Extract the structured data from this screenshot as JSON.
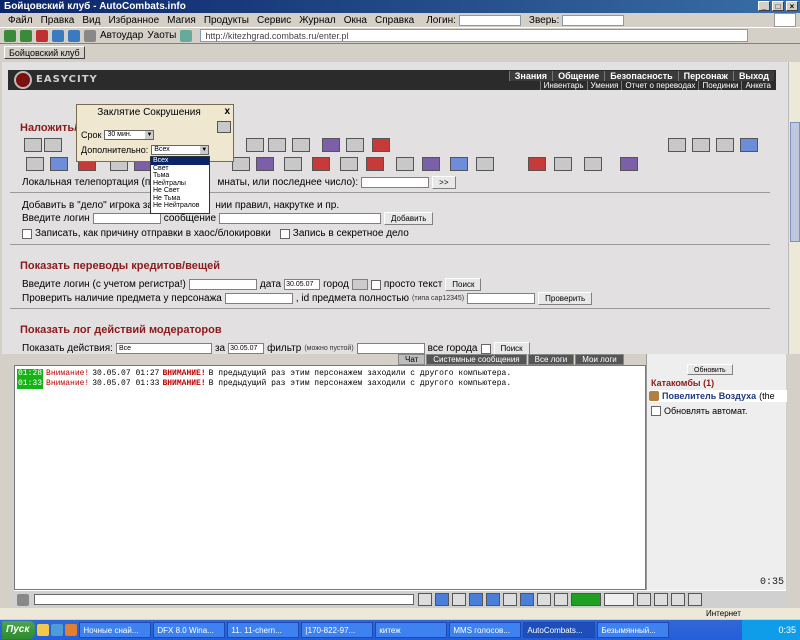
{
  "window": {
    "title": "Бойцовский клуб - AutoCombats.info"
  },
  "menu": [
    "Файл",
    "Правка",
    "Вид",
    "Избранное",
    "Магия",
    "Продукты",
    "Сервис",
    "Журнал",
    "Окна",
    "Справка"
  ],
  "menu_fields": {
    "login_label": "Логин:",
    "beast_label": "Зверь:"
  },
  "toolbar": {
    "autoudar": "Автоудар",
    "uaoty": "Уаоты",
    "address": "http://kitezhgrad.combats.ru/enter.pl"
  },
  "tab": {
    "label": "Бойцовский клуб"
  },
  "banner": {
    "brand": "EASYCITY",
    "nav_top": [
      "Знания",
      "Общение",
      "Безопасность",
      "Персонаж",
      "Выход"
    ],
    "nav_bottom": [
      "Инвентарь",
      "Умения",
      "Отчет о переводах",
      "Поединки",
      "Анкета"
    ]
  },
  "section1": {
    "title": "Наложить/сн",
    "teleport_label": "Локальная телепортация (пол",
    "teleport_label2": "мнаты, или последнее число):",
    "teleport_btn": ">>",
    "delo_label": "Добавить в \"дело\" игрока заме",
    "delo_label2": "нии правил, накрутке и пр.",
    "login_label": "Введите логин",
    "message_label": "сообщение",
    "add_btn": "Добавить",
    "chaos_label": "Записать, как причину отправки в хаос/блокировки",
    "secret_label": "Запись в секретное дело"
  },
  "popup": {
    "title": "Заклятие Сокрушения",
    "close": "x",
    "term_label": "Срок",
    "term_value": "30 мин.",
    "extra_label": "Дополнительно:",
    "extra_value": "Всех",
    "options": [
      "Всех",
      "Свет",
      "Тьма",
      "Нейтралы",
      "Не Свет",
      "Не Тьма",
      "Не Нейтралов"
    ]
  },
  "section2": {
    "title": "Показать переводы кредитов/вещей",
    "login_label": "Введите логин (с учетом регистра!)",
    "date_label": "дата",
    "date_value": "30.05.07",
    "city_label": "город",
    "plain_label": "просто текст",
    "search_btn": "Поиск",
    "check_label": "Проверить наличие предмета у персонажа",
    "item_id_label": ", id предмета полностью",
    "item_hint": "(типа cap12345)",
    "check_btn": "Проверить"
  },
  "section3": {
    "title": "Показать лог действий модераторов",
    "actions_label": "Показать действия:",
    "actions_value": "Все",
    "for_label": "за",
    "date_value": "30.05.07",
    "filter_label": "фильтр",
    "filter_hint": "(можно пустой)",
    "all_cities_label": "все города",
    "search_btn": "Поиск"
  },
  "chat_tabs": [
    "Чат",
    "Системные сообщения",
    "Все логи",
    "Мои логи"
  ],
  "chat_lines": [
    {
      "time": "01:28",
      "prefix": "Внимание!",
      "date": "30.05.07 01:27",
      "alert": "ВНИМАНИЕ!",
      "text": "В предыдущий раз этим персонажем заходили с другого компьютера."
    },
    {
      "time": "01:33",
      "prefix": "Внимание!",
      "date": "30.05.07 01:33",
      "alert": "ВНИМАНИЕ!",
      "text": "В предыдущий раз этим персонажем заходили с другого компьютера."
    }
  ],
  "side": {
    "refresh_btn": "Обновить",
    "location": "Катакомбы (1)",
    "player": "Повелитель Воздуха",
    "player_suffix": "(the",
    "auto_label": "Обновлять автомат.",
    "clock": "0:35"
  },
  "status": {
    "zone": "Интернет"
  },
  "taskbar": {
    "start": "Пуск",
    "tasks": [
      "Ночные снай...",
      "DFX 8.0 Wina...",
      "11. 11-chern...",
      "[170-822-97...",
      "китеж",
      "MMS голосов...",
      "AutoCombats...",
      "Безымянный..."
    ],
    "time": "0:35"
  }
}
